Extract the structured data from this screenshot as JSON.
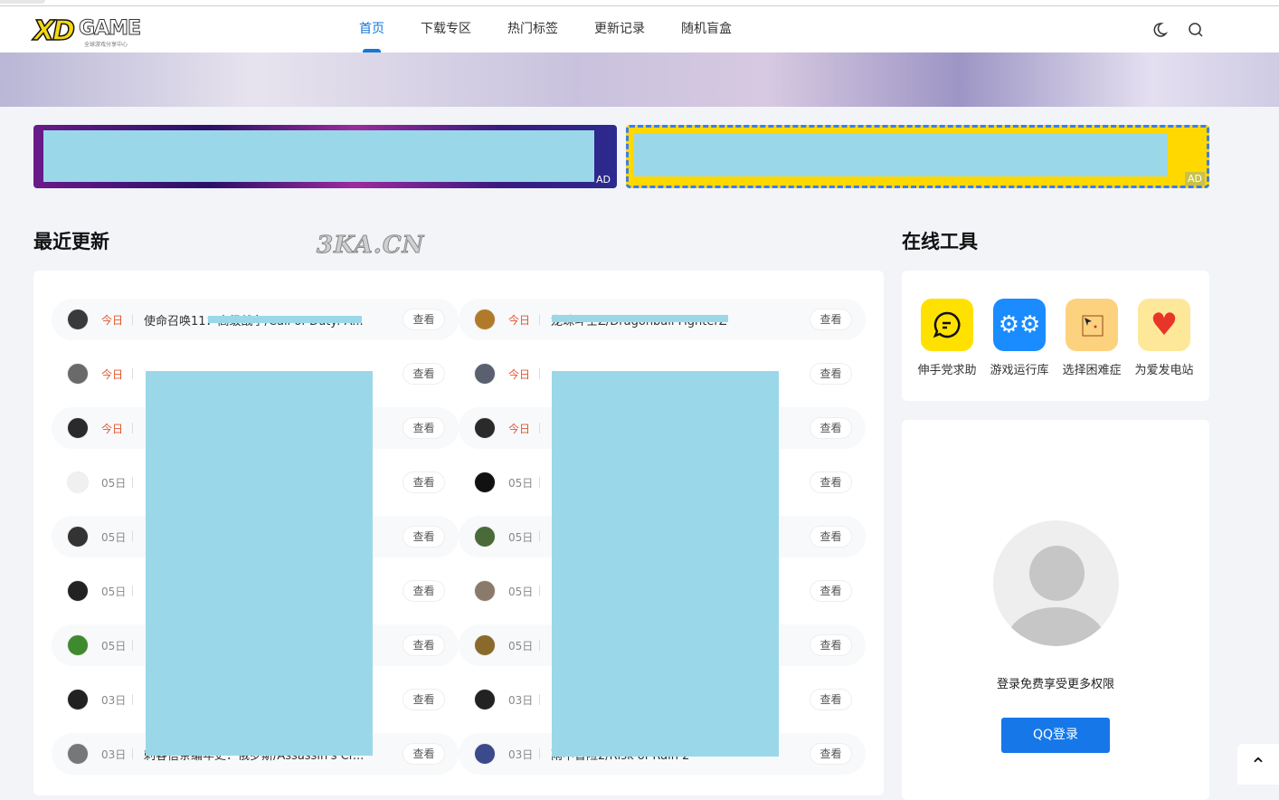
{
  "header": {
    "logo": {
      "main": "XD",
      "secondary": "GAME",
      "tagline": "全球游戏分享中心"
    },
    "nav": [
      {
        "label": "首页",
        "active": true
      },
      {
        "label": "下载专区"
      },
      {
        "label": "热门标签"
      },
      {
        "label": "更新记录"
      },
      {
        "label": "随机盲盒"
      }
    ],
    "icons": [
      "moon-icon",
      "search-icon"
    ]
  },
  "ads": [
    {
      "tag": "AD"
    },
    {
      "tag": "AD"
    }
  ],
  "watermark": "3KA.CN",
  "recent": {
    "title": "最近更新",
    "view_label": "查看",
    "left": [
      {
        "date": "今日",
        "today": true,
        "title": "使命召唤11：高级战争/Call of Duty: A..."
      },
      {
        "date": "今日",
        "today": true,
        "title": ""
      },
      {
        "date": "今日",
        "today": true,
        "title": ""
      },
      {
        "date": "05日",
        "today": false,
        "title": ""
      },
      {
        "date": "05日",
        "today": false,
        "title": ""
      },
      {
        "date": "05日",
        "today": false,
        "title": ""
      },
      {
        "date": "05日",
        "today": false,
        "title": ""
      },
      {
        "date": "03日",
        "today": false,
        "title": ""
      },
      {
        "date": "03日",
        "today": false,
        "title": "刺客信条编年史：俄罗斯/Assassin's Cr..."
      }
    ],
    "right": [
      {
        "date": "今日",
        "today": true,
        "title": "龙珠斗士Z/Dragonball FighterZ"
      },
      {
        "date": "今日",
        "today": true,
        "title": ""
      },
      {
        "date": "今日",
        "today": true,
        "title": ""
      },
      {
        "date": "05日",
        "today": false,
        "title": ""
      },
      {
        "date": "05日",
        "today": false,
        "title": ""
      },
      {
        "date": "05日",
        "today": false,
        "title": ""
      },
      {
        "date": "05日",
        "today": false,
        "title": ""
      },
      {
        "date": "03日",
        "today": false,
        "title": ""
      },
      {
        "date": "03日",
        "today": false,
        "title": "雨中冒险2/Risk of Rain 2"
      }
    ]
  },
  "tools": {
    "title": "在线工具",
    "items": [
      {
        "label": "伸手党求助",
        "icon": "chat-bubble-icon",
        "color": "#ffe100"
      },
      {
        "label": "游戏运行库",
        "icon": "gears-icon",
        "color": "#1a8cff"
      },
      {
        "label": "选择困难症",
        "icon": "cursor-select-icon",
        "color": "#fdd27e"
      },
      {
        "label": "为爱发电站",
        "icon": "heart-hands-icon",
        "color": "#fde89a"
      }
    ]
  },
  "login": {
    "prompt": "登录免费享受更多权限",
    "button": "QQ登录"
  },
  "colors": {
    "accent": "#1677d8",
    "today": "#e0552f"
  }
}
